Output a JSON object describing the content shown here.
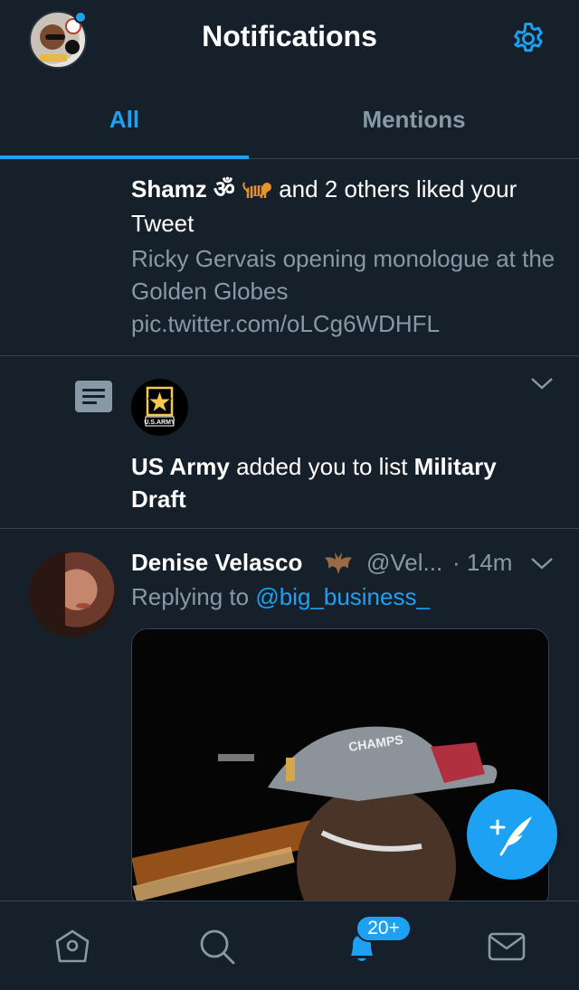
{
  "header": {
    "title": "Notifications",
    "profile_icon": "profile-avatar-icon",
    "settings_icon": "gear-icon"
  },
  "tabs": [
    {
      "label": "All",
      "active": true
    },
    {
      "label": "Mentions",
      "active": false
    }
  ],
  "notifications": [
    {
      "type": "like",
      "actor_name": "Shamz ॐ",
      "actor_emoji": "tiger",
      "action_text": " and 2 others liked your Tweet",
      "tweet_text": "Ricky Gervais opening monologue at the Golden Globes pic.twitter.com/oLCg6WDHFL"
    },
    {
      "type": "list_add",
      "actor_name": "US Army",
      "action_text": " added you to list ",
      "list_name": "Military Draft",
      "avatar_label": "U.S.ARMY",
      "icon": "list-icon"
    }
  ],
  "tweet": {
    "name": "Denise Velasco",
    "name_emoji": "bat",
    "handle": "@Vel...",
    "time": "· 14m",
    "reply_prefix": "Replying to ",
    "reply_to": "@big_business_",
    "media_caption": "CHAMPS"
  },
  "compose_button": "compose-tweet-icon",
  "bottom_nav": {
    "items": [
      "home-icon",
      "search-icon",
      "notifications-bell-icon",
      "messages-icon"
    ],
    "notifications_badge": "20+"
  },
  "colors": {
    "background": "#15202b",
    "accent": "#1da1f2",
    "secondary_text": "#8899a6",
    "divider": "#38444d"
  }
}
